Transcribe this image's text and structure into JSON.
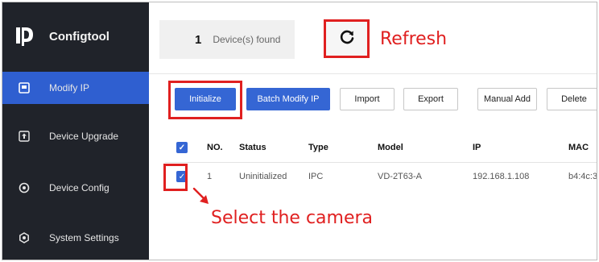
{
  "app": {
    "name": "Configtool",
    "accent_color": "#3566d4",
    "sidebar_color": "#20232a",
    "annotation_color": "#e02020"
  },
  "sidebar": {
    "items": [
      {
        "label": "Modify IP",
        "icon": "modify-ip-icon",
        "active": true
      },
      {
        "label": "Device Upgrade",
        "icon": "upload-icon",
        "active": false
      },
      {
        "label": "Device Config",
        "icon": "gear-icon",
        "active": false
      },
      {
        "label": "System Settings",
        "icon": "settings-icon",
        "active": false
      }
    ]
  },
  "header": {
    "found_count": "1",
    "found_label": "Device(s) found",
    "refresh_icon": "refresh-icon"
  },
  "toolbar": {
    "initialize": "Initialize",
    "batch_modify_ip": "Batch Modify IP",
    "import": "Import",
    "export": "Export",
    "manual_add": "Manual Add",
    "delete": "Delete"
  },
  "table": {
    "columns": {
      "no": "NO.",
      "status": "Status",
      "type": "Type",
      "model": "Model",
      "ip": "IP",
      "mac": "MAC"
    },
    "rows": [
      {
        "no": "1",
        "status": "Uninitialized",
        "type": "IPC",
        "model": "VD-2T63-A",
        "ip": "192.168.1.108",
        "mac": "b4:4c:3",
        "checked": true
      }
    ]
  },
  "annotations": {
    "refresh": "Refresh",
    "select_camera": "Select the camera"
  }
}
